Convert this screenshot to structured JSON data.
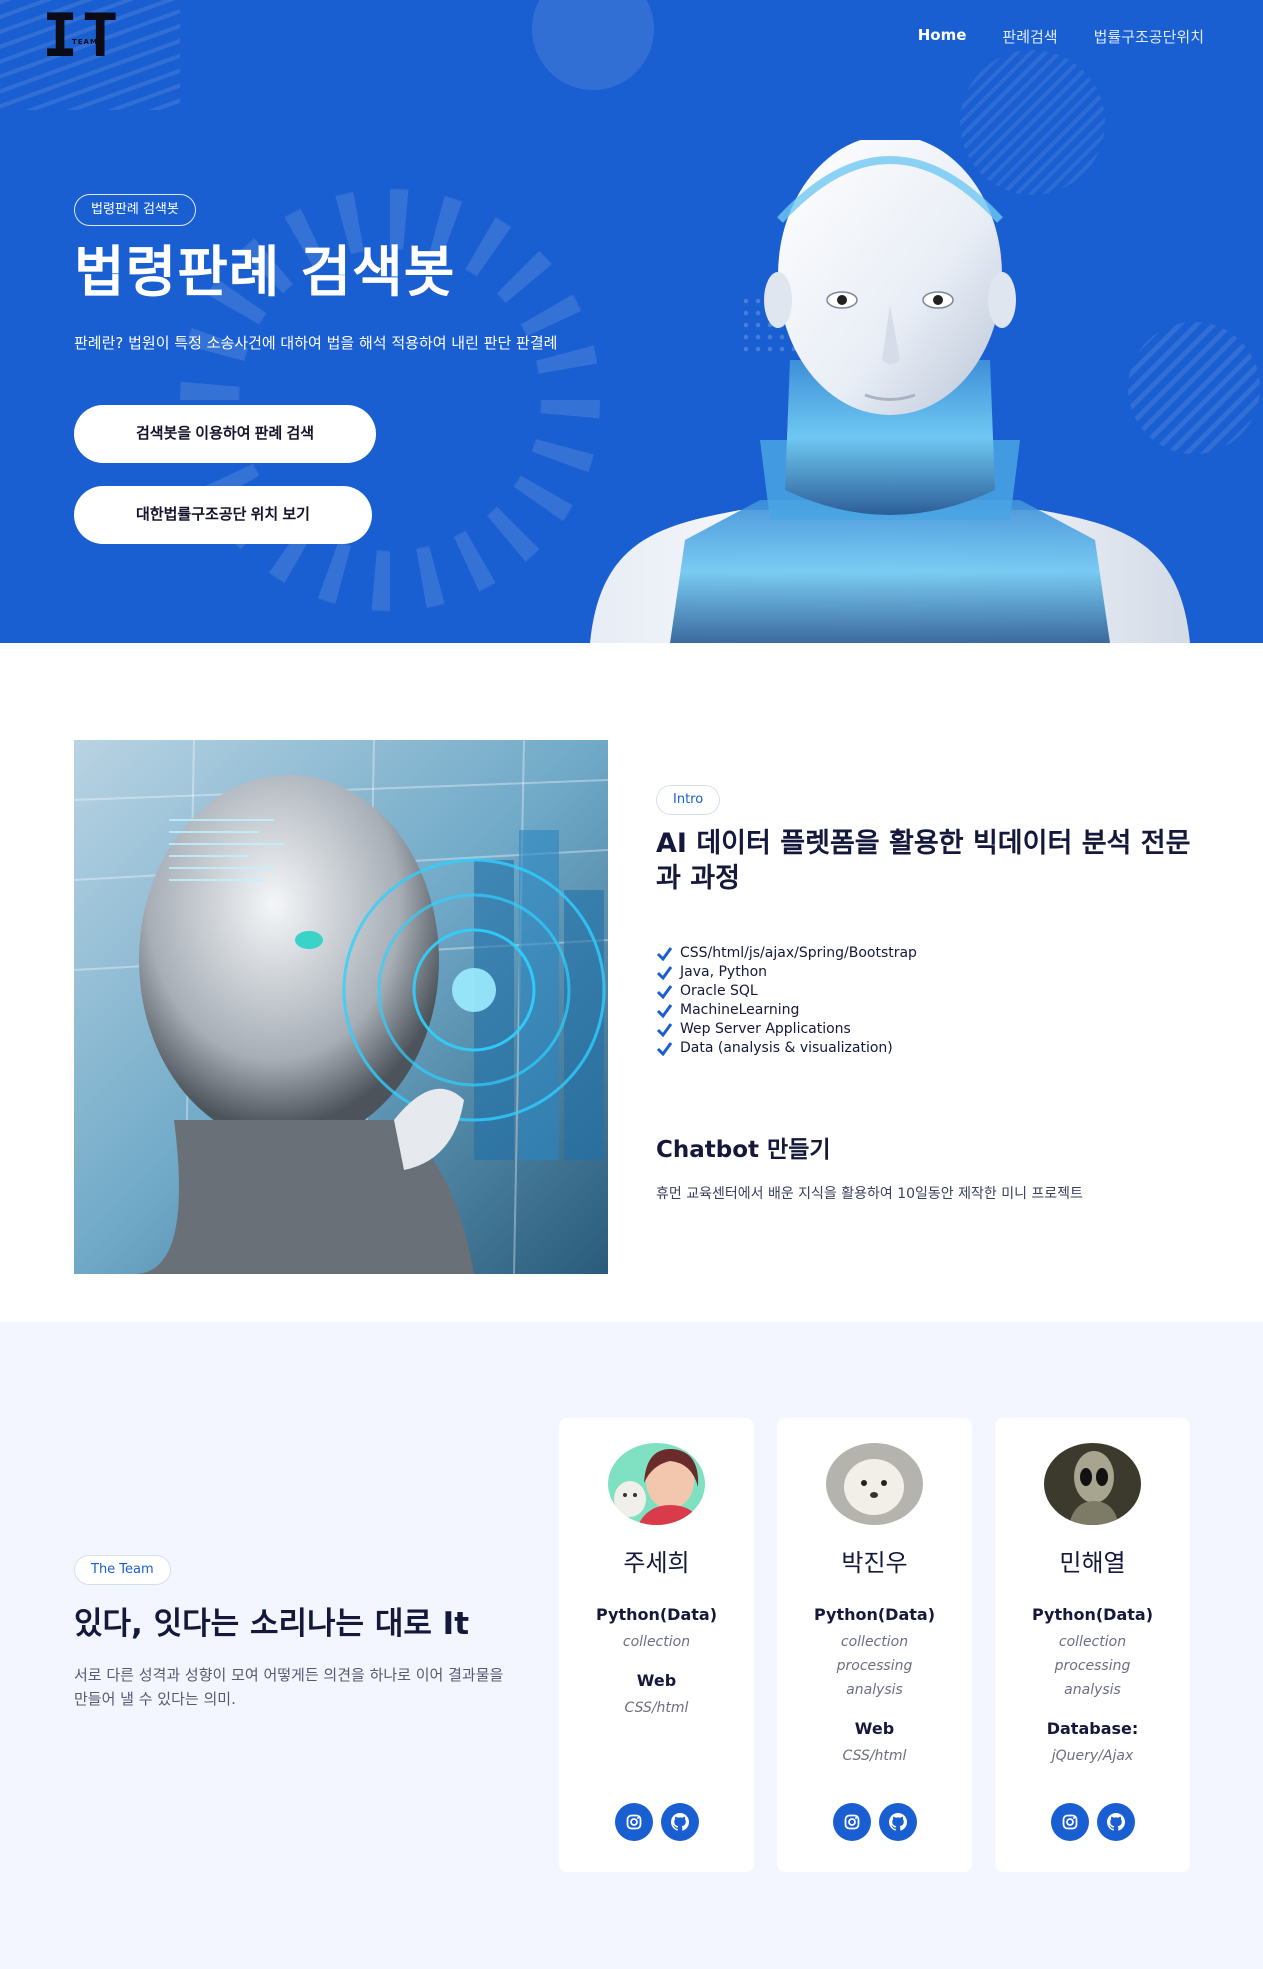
{
  "logo": {
    "mark": "IT",
    "sub": "TEAM"
  },
  "nav": [
    {
      "label": "Home",
      "active": true
    },
    {
      "label": "판례검색",
      "active": false
    },
    {
      "label": "법률구조공단위치",
      "active": false
    }
  ],
  "hero": {
    "badge": "법령판례 검색봇",
    "title": "법령판례 검색봇",
    "description": "판례란? 법원이 특정 소송사건에 대하여 법을 해석 적용하여 내린 판단 판결례",
    "button_search": "검색봇을 이용하여 판례 검색",
    "button_location": "대한법률구조공단 위치 보기"
  },
  "intro": {
    "tag": "Intro",
    "title": "AI 데이터 플렛폼을 활용한 빅데이터 분석 전문과 과정",
    "checklist": [
      "CSS/html/js/ajax/Spring/Bootstrap",
      "Java, Python",
      "Oracle SQL",
      "MachineLearning",
      "Wep Server Applications",
      "Data (analysis & visualization)"
    ],
    "chatbot_title": "Chatbot 만들기",
    "chatbot_desc": "휴먼 교육센터에서 배운 지식을 활용하여 10일동안 제작한 미니 프로젝트"
  },
  "team": {
    "tag": "The Team",
    "title": "있다, 잇다는 소리나는 대로 It",
    "description": "서로 다른 성격과 성향이 모여 어떻게든 의견을 하나로 이어 결과물을 만들어 낼 수 있다는 의미.",
    "members": [
      {
        "name": "주세희",
        "role1": "Python(Data)",
        "detail1": [
          "collection"
        ],
        "role2": "Web",
        "detail2": "CSS/html"
      },
      {
        "name": "박진우",
        "role1": "Python(Data)",
        "detail1": [
          "collection",
          "processing",
          "analysis"
        ],
        "role2": "Web",
        "detail2": "CSS/html"
      },
      {
        "name": "민해열",
        "role1": "Python(Data)",
        "detail1": [
          "collection",
          "processing",
          "analysis"
        ],
        "role2": "Database:",
        "detail2": "jQuery/Ajax"
      }
    ]
  },
  "icons": {
    "check": "check-icon",
    "instagram": "instagram-icon",
    "github": "github-icon"
  },
  "colors": {
    "primary": "#1a5fd1",
    "heading": "#14183b",
    "team_bg": "#f3f6fe"
  }
}
